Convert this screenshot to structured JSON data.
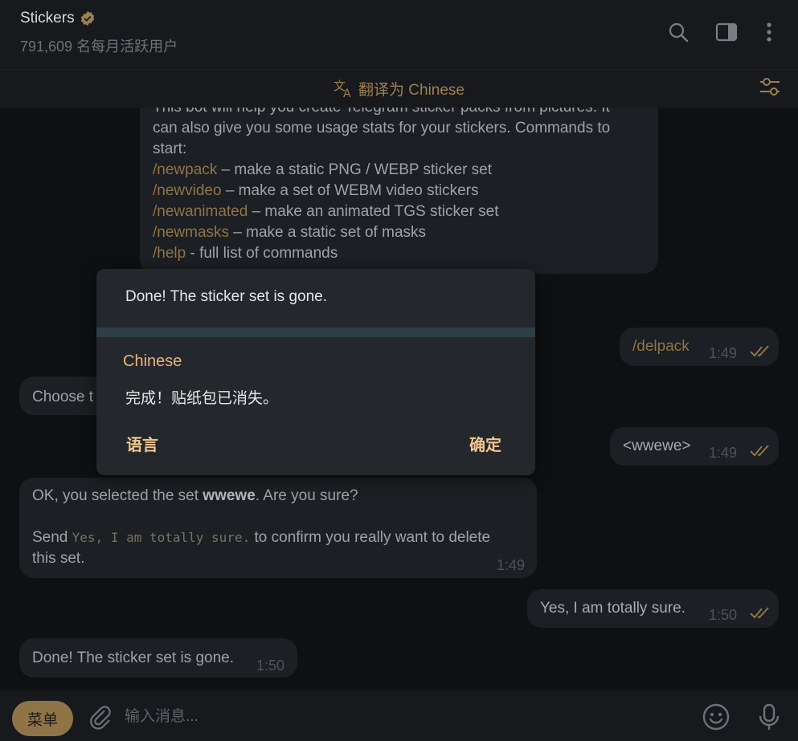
{
  "header": {
    "title": "Stickers",
    "subtitle": "791,609 名每月活跃用户"
  },
  "translate_bar": {
    "label": "翻译为 Chinese"
  },
  "messages": {
    "bot_intro": {
      "partial_line": "This bot will help you create Telegram sticker packs from pictures. It",
      "line2": "can also give you some usage stats for your stickers. Commands to",
      "line3": "start:",
      "commands": [
        {
          "cmd": "/newpack",
          "desc": " – make a static PNG / WEBP sticker set"
        },
        {
          "cmd": "/newvideo",
          "desc": " – make a set of WEBM video stickers"
        },
        {
          "cmd": "/newanimated",
          "desc": " – make an animated TGS sticker set"
        },
        {
          "cmd": "/newmasks",
          "desc": " – make a static set of masks"
        },
        {
          "cmd": "/help",
          "desc": " - full list of commands"
        }
      ]
    },
    "out_delpack": {
      "text": "/delpack",
      "time": "1:49"
    },
    "in_choose": {
      "text": "Choose t"
    },
    "out_wwewe": {
      "text": "<wwewe>",
      "time": "1:49"
    },
    "in_confirm": {
      "line1_a": "OK, you selected the set ",
      "line1_bold": "wwewe",
      "line1_b": ". Are you sure?",
      "line2_a": "Send ",
      "line2_code": "Yes, I am totally sure.",
      "line2_b": " to confirm you really want to delete",
      "line3": "this set.",
      "time": "1:49"
    },
    "out_sure": {
      "text": "Yes, I am totally sure.",
      "time": "1:50"
    },
    "in_done": {
      "text": "Done! The sticker set is gone.",
      "time": "1:50"
    }
  },
  "translate_popup": {
    "original": "Done! The sticker set is gone.",
    "language": "Chinese",
    "translated": "完成！贴纸包已消失。",
    "language_button": "语言",
    "ok_button": "确定"
  },
  "input_bar": {
    "menu_label": "菜单",
    "placeholder": "输入消息..."
  },
  "colors": {
    "accent": "#8f7447",
    "popup_accent": "#f1c791",
    "language_label": "#e8b57c"
  }
}
